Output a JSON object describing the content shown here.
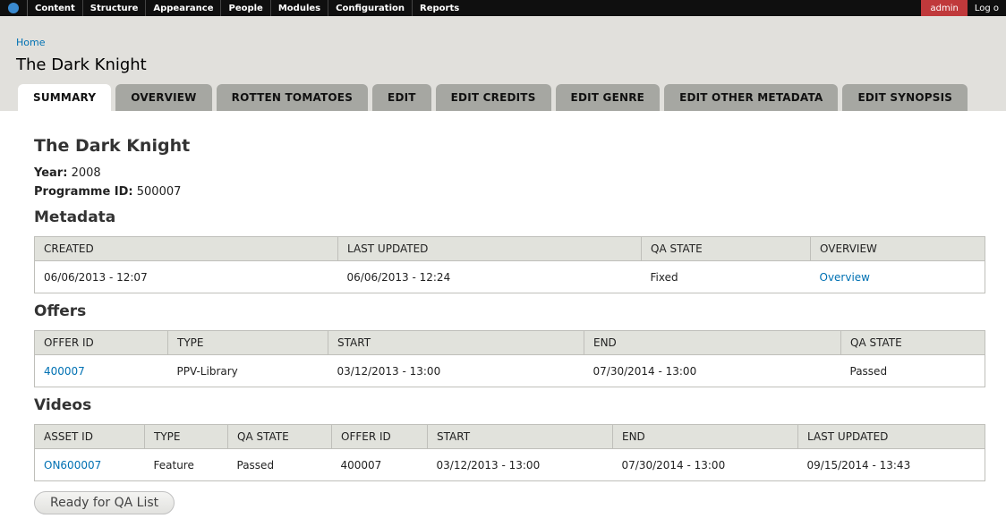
{
  "toolbar": {
    "logo_icon": "drupal-drop-icon",
    "menu": [
      "Content",
      "Structure",
      "Appearance",
      "People",
      "Modules",
      "Configuration",
      "Reports"
    ],
    "user": "admin",
    "logout": "Log o"
  },
  "header": {
    "breadcrumb": "Home",
    "title": "The Dark Knight",
    "tabs": [
      "SUMMARY",
      "OVERVIEW",
      "ROTTEN TOMATOES",
      "EDIT",
      "EDIT CREDITS",
      "EDIT GENRE",
      "EDIT OTHER METADATA",
      "EDIT SYNOPSIS"
    ],
    "active_tab": "SUMMARY"
  },
  "summary": {
    "title": "The Dark Knight",
    "year_label": "Year:",
    "year": "2008",
    "programme_label": "Programme ID:",
    "programme_id": "500007"
  },
  "metadata": {
    "heading": "Metadata",
    "columns": [
      "CREATED",
      "LAST UPDATED",
      "QA STATE",
      "OVERVIEW"
    ],
    "rows": [
      [
        "06/06/2013 - 12:07",
        "06/06/2013 - 12:24",
        "Fixed",
        "Overview"
      ]
    ]
  },
  "offers": {
    "heading": "Offers",
    "columns": [
      "OFFER ID",
      "TYPE",
      "START",
      "END",
      "QA STATE"
    ],
    "rows": [
      [
        "400007",
        "PPV-Library",
        "03/12/2013 - 13:00",
        "07/30/2014 - 13:00",
        "Passed"
      ]
    ]
  },
  "videos": {
    "heading": "Videos",
    "columns": [
      "ASSET ID",
      "TYPE",
      "QA STATE",
      "OFFER ID",
      "START",
      "END",
      "LAST UPDATED"
    ],
    "rows": [
      [
        "ON600007",
        "Feature",
        "Passed",
        "400007",
        "03/12/2013 - 13:00",
        "07/30/2014 - 13:00",
        "09/15/2014 - 13:43"
      ]
    ]
  },
  "button": {
    "label": "Ready for QA List"
  },
  "colors": {
    "toolbar_bg": "#0f0f0f",
    "user_bg": "#c0393b",
    "header_bg": "#e1e0dc",
    "link": "#0071b3",
    "tab_bg": "#a6a7a2"
  }
}
